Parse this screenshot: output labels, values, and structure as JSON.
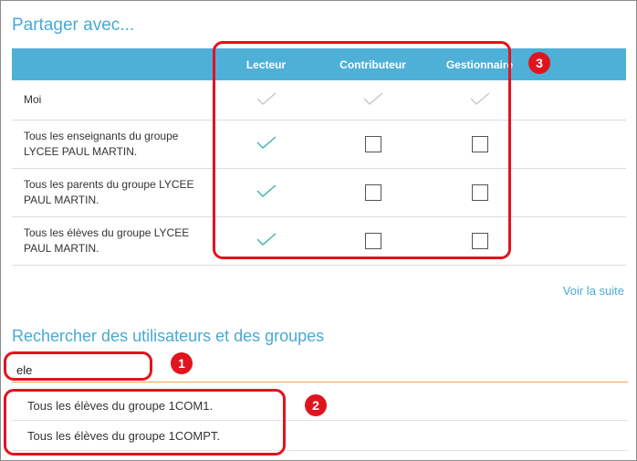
{
  "share": {
    "title": "Partager avec...",
    "columns": [
      "Lecteur",
      "Contributeur",
      "Gestionnaire"
    ],
    "rows": [
      {
        "name": "Moi",
        "rights": [
          "checked-disabled",
          "checked-disabled",
          "checked-disabled"
        ]
      },
      {
        "name": "Tous les enseignants du groupe LYCEE PAUL MARTIN.",
        "rights": [
          "checked",
          "unchecked",
          "unchecked"
        ]
      },
      {
        "name": "Tous les parents du groupe LYCEE PAUL MARTIN.",
        "rights": [
          "checked",
          "unchecked",
          "unchecked"
        ]
      },
      {
        "name": "Tous les élèves du groupe LYCEE PAUL MARTIN.",
        "rights": [
          "checked",
          "unchecked",
          "unchecked"
        ]
      }
    ],
    "more_link": "Voir la suite"
  },
  "search": {
    "title": "Rechercher des utilisateurs et des groupes",
    "value": "ele",
    "results": [
      "Tous les élèves du groupe 1COM1.",
      "Tous les élèves du groupe 1COMPT."
    ]
  },
  "annotations": {
    "badges": [
      "1",
      "2",
      "3"
    ]
  },
  "colors": {
    "accent": "#4aa9d4",
    "header_bg": "#4fb0d7",
    "check": "#3cb4a8",
    "check_disabled": "#c8c8c8",
    "annotation": "#e0141e",
    "search_underline": "#f0a050"
  }
}
